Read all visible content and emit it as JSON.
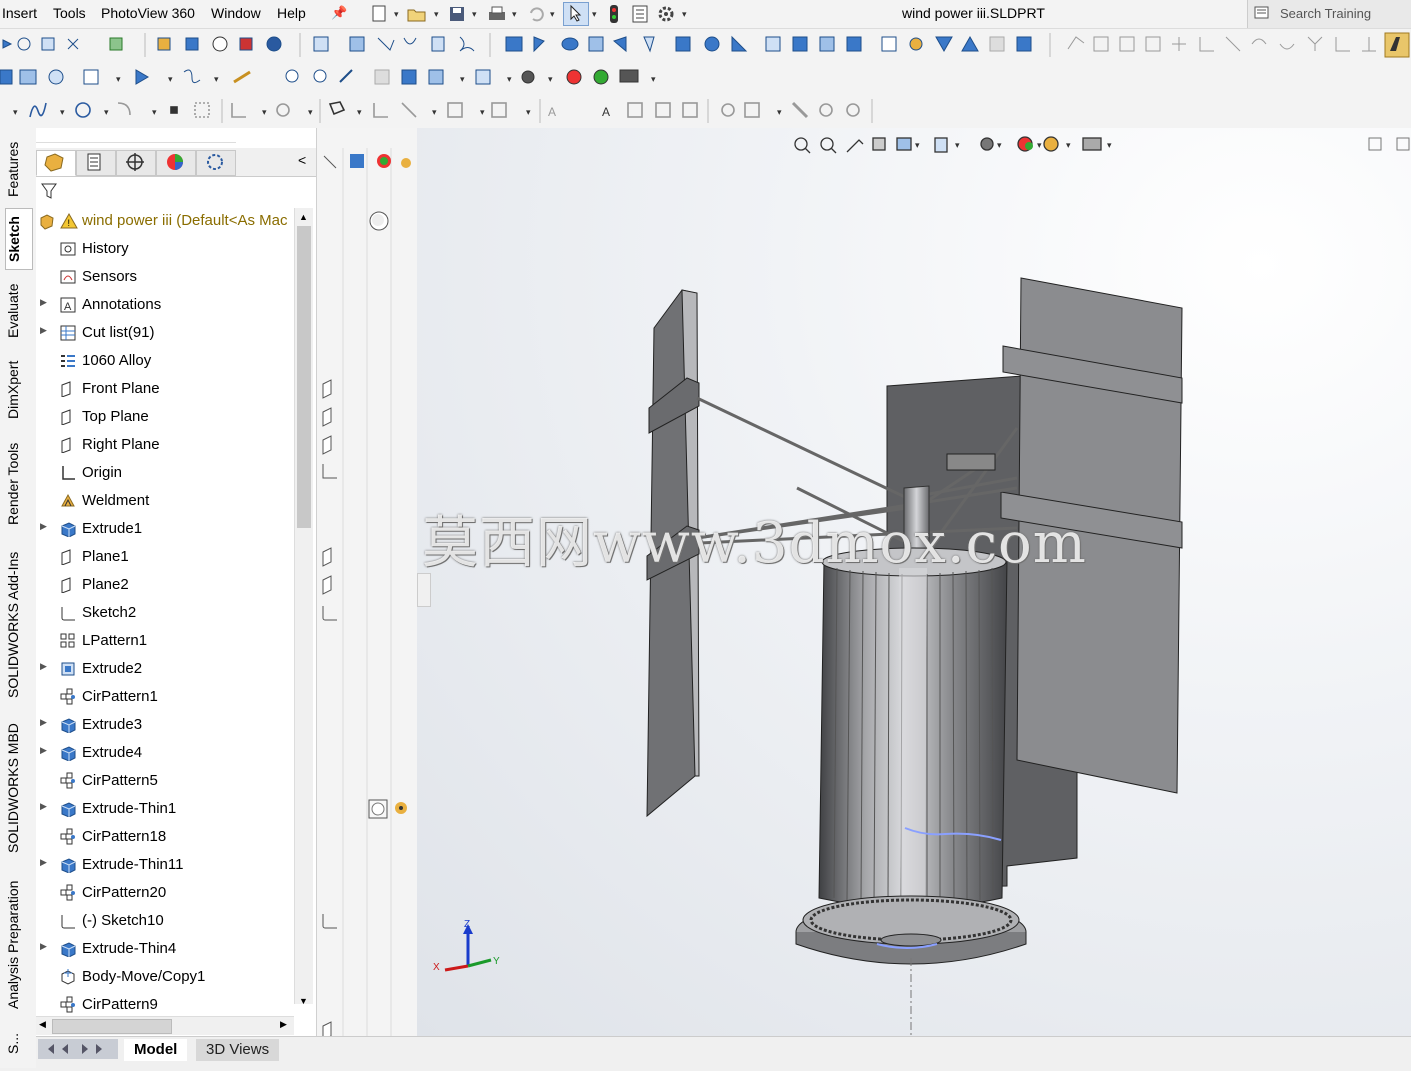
{
  "menubar": {
    "items": [
      "Insert",
      "Tools",
      "PhotoView 360",
      "Window",
      "Help"
    ],
    "document_title": "wind power iii.SLDPRT",
    "search_placeholder": "Search Training"
  },
  "feature_manager": {
    "root": "wind power iii  (Default<As Mac",
    "items": [
      {
        "label": "History",
        "icon": "history-icon",
        "expandable": false
      },
      {
        "label": "Sensors",
        "icon": "sensors-icon",
        "expandable": false
      },
      {
        "label": "Annotations",
        "icon": "annotations-icon",
        "expandable": true
      },
      {
        "label": "Cut list(91)",
        "icon": "cut-list-icon",
        "expandable": true
      },
      {
        "label": "1060 Alloy",
        "icon": "material-icon",
        "expandable": false
      },
      {
        "label": "Front Plane",
        "icon": "plane-icon",
        "expandable": false
      },
      {
        "label": "Top Plane",
        "icon": "plane-icon",
        "expandable": false
      },
      {
        "label": "Right Plane",
        "icon": "plane-icon",
        "expandable": false
      },
      {
        "label": "Origin",
        "icon": "origin-icon",
        "expandable": false
      },
      {
        "label": "Weldment",
        "icon": "weldment-icon",
        "expandable": false
      },
      {
        "label": "Extrude1",
        "icon": "extrude-icon",
        "expandable": true
      },
      {
        "label": "Plane1",
        "icon": "plane-icon",
        "expandable": false
      },
      {
        "label": "Plane2",
        "icon": "plane-icon",
        "expandable": false
      },
      {
        "label": "Sketch2",
        "icon": "sketch-icon",
        "expandable": false
      },
      {
        "label": "LPattern1",
        "icon": "linear-pattern-icon",
        "expandable": false
      },
      {
        "label": "Extrude2",
        "icon": "extrude-cut-icon",
        "expandable": true
      },
      {
        "label": "CirPattern1",
        "icon": "circular-pattern-icon",
        "expandable": false
      },
      {
        "label": "Extrude3",
        "icon": "extrude-icon",
        "expandable": true
      },
      {
        "label": "Extrude4",
        "icon": "extrude-icon",
        "expandable": true
      },
      {
        "label": "CirPattern5",
        "icon": "circular-pattern-icon",
        "expandable": false
      },
      {
        "label": "Extrude-Thin1",
        "icon": "extrude-icon",
        "expandable": true
      },
      {
        "label": "CirPattern18",
        "icon": "circular-pattern-icon",
        "expandable": false
      },
      {
        "label": "Extrude-Thin11",
        "icon": "extrude-icon",
        "expandable": true
      },
      {
        "label": "CirPattern20",
        "icon": "circular-pattern-icon",
        "expandable": false
      },
      {
        "label": "(-) Sketch10",
        "icon": "sketch-icon",
        "expandable": false
      },
      {
        "label": "Extrude-Thin4",
        "icon": "extrude-icon",
        "expandable": true
      },
      {
        "label": "Body-Move/Copy1",
        "icon": "move-copy-icon",
        "expandable": false
      },
      {
        "label": "CirPattern9",
        "icon": "circular-pattern-icon",
        "expandable": false
      }
    ]
  },
  "side_tabs": [
    "Features",
    "Sketch",
    "Evaluate",
    "DimXpert",
    "Render Tools",
    "SOLIDWORKS Add-Ins",
    "SOLIDWORKS MBD",
    "Analysis Preparation",
    "S..."
  ],
  "active_side_tab": "Sketch",
  "bottom_tabs": [
    "Model",
    "3D Views"
  ],
  "active_bottom_tab": "Model",
  "watermark": "莫西网www.3dmox.com",
  "triad_labels": {
    "z": "Z",
    "x": "X",
    "y": "Y"
  },
  "colors": {
    "model_gray": "#8a8b8d",
    "model_dark": "#5e5f61",
    "root_text": "#8a6d00"
  }
}
